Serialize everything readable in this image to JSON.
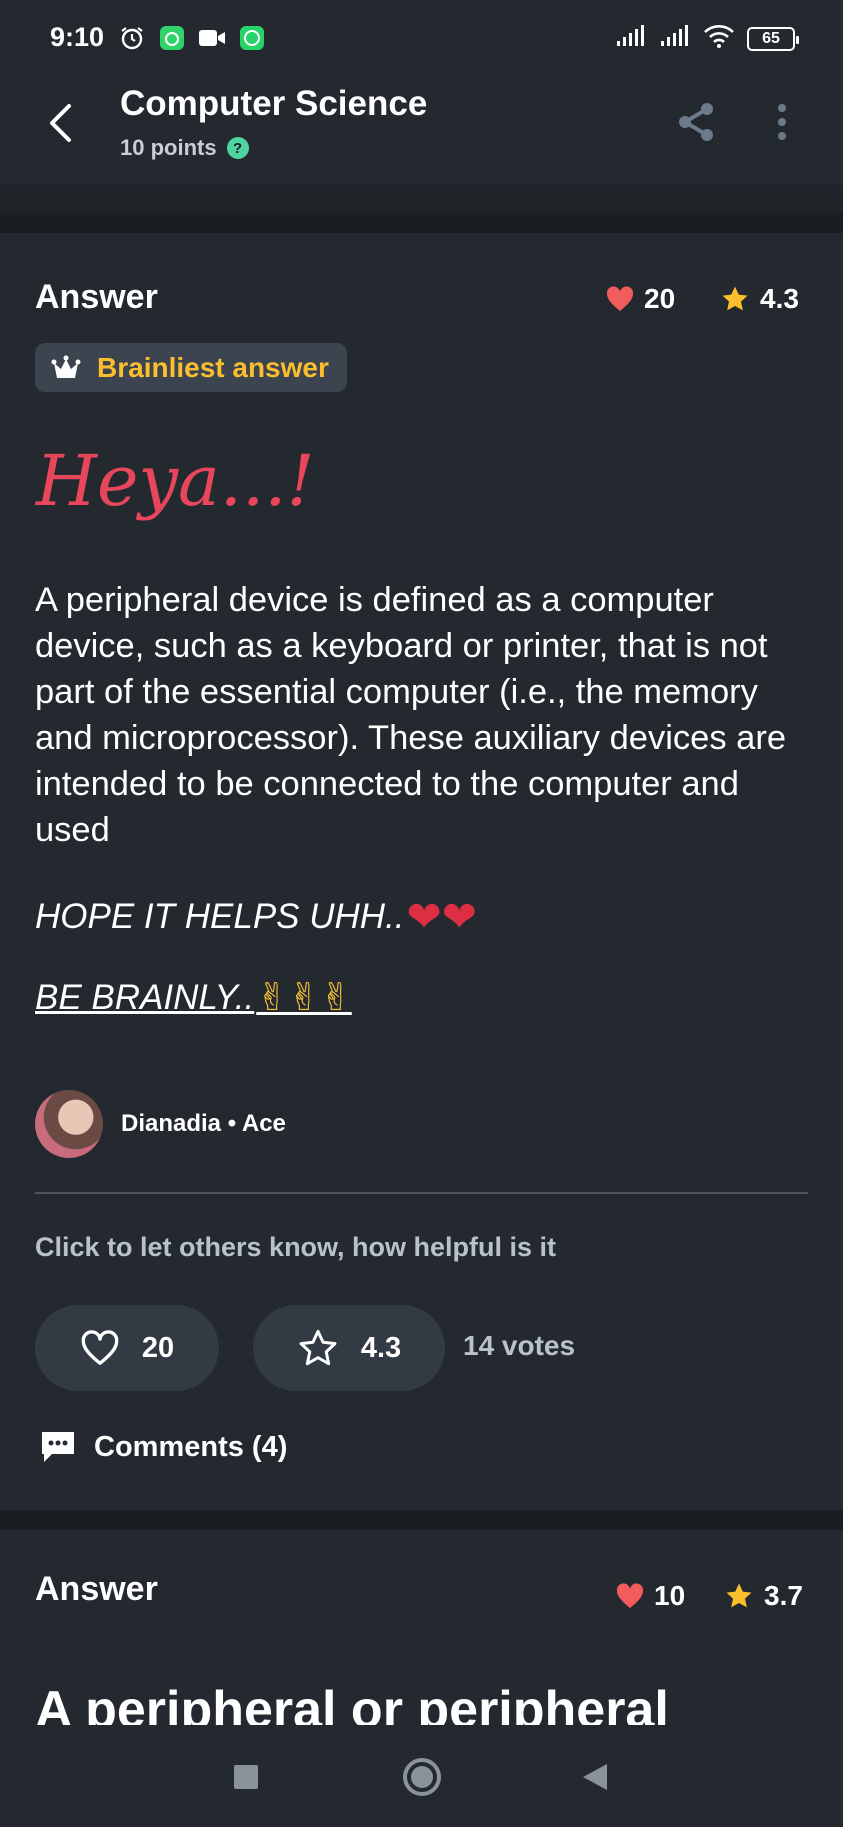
{
  "status_bar": {
    "time": "9:10",
    "battery": "65",
    "icons_left": [
      "alarm-icon",
      "app-icon",
      "video-icon",
      "whatsapp-icon"
    ],
    "icons_right": [
      "signal-icon",
      "signal-icon",
      "wifi-icon",
      "battery-icon"
    ]
  },
  "header": {
    "title": "Computer Science",
    "subtitle": "10 points",
    "help_icon": "?"
  },
  "answer1": {
    "label": "Answer",
    "likes": "20",
    "rating": "4.3",
    "badge": "Brainliest answer",
    "heading": "Heya...!",
    "body": "A peripheral device is defined as a computer device, such as a keyboard or printer, that is not part of the essential computer (i.e., the memory and microprocessor). These auxiliary devices are intended to be connected to the computer and used",
    "hope_text": "HOPE IT HELPS UHH..",
    "brainly_text": "BE BRAINLY..",
    "author": "Dianadia • Ace",
    "prompt": "Click to let others know, how helpful is it",
    "like_btn": "20",
    "rate_btn": "4.3",
    "votes": "14 votes",
    "comments": "Comments (4)"
  },
  "answer2": {
    "label": "Answer",
    "likes": "10",
    "rating": "3.7",
    "preview": "A peripheral or peripheral"
  },
  "colors": {
    "background": "#242930",
    "heart": "#f25c5c",
    "star": "#fbbf2e",
    "badge_text": "#fbbf2e",
    "heading": "#e8475b"
  }
}
